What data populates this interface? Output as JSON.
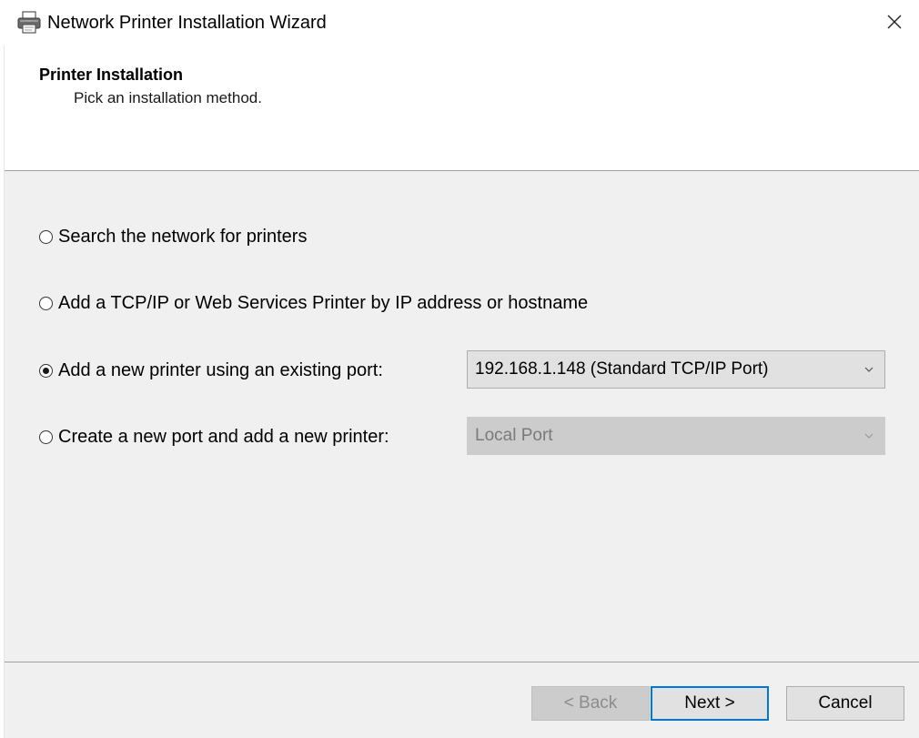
{
  "window": {
    "title": "Network Printer Installation Wizard",
    "title_icon": "printer-icon",
    "close_icon": "close-icon"
  },
  "header": {
    "title": "Printer Installation",
    "subtitle": "Pick an installation method."
  },
  "options": [
    {
      "label": "Search the network for printers",
      "selected": false
    },
    {
      "label": "Add a TCP/IP or Web Services Printer by IP address or hostname",
      "selected": false
    },
    {
      "label": "Add a new printer using an existing port:",
      "selected": true
    },
    {
      "label": "Create a new port and add a new printer:",
      "selected": false
    }
  ],
  "existing_port_select": {
    "value": "192.168.1.148 (Standard TCP/IP Port)",
    "enabled": true
  },
  "new_port_select": {
    "value": "Local Port",
    "enabled": false
  },
  "buttons": {
    "back": "< Back",
    "next": "Next >",
    "cancel": "Cancel"
  },
  "colors": {
    "accent": "#0078d7",
    "content_bg": "#f0f0f0",
    "header_bg": "#ffffff"
  }
}
